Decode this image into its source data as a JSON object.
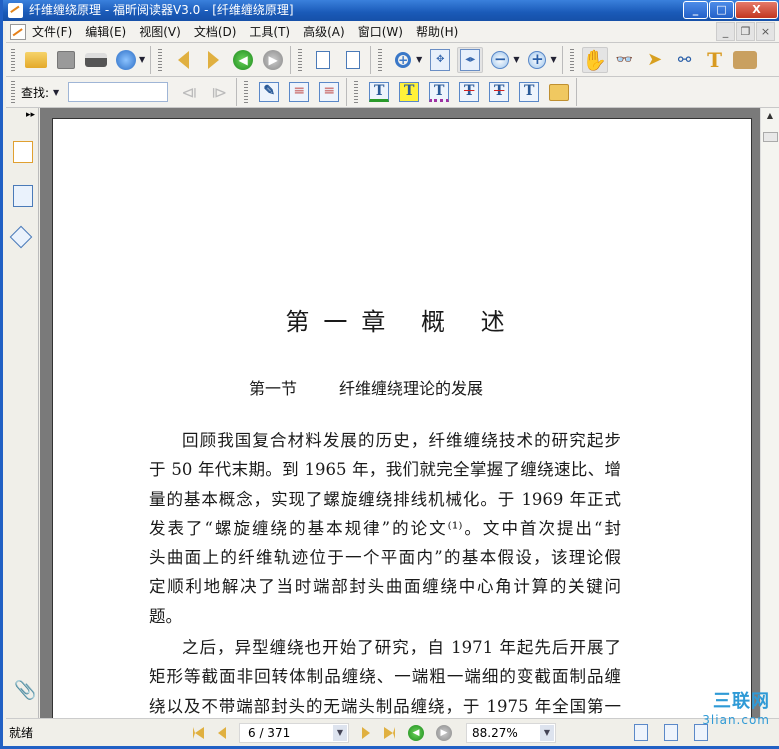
{
  "window": {
    "title": "纤维缠绕原理 - 福昕阅读器V3.0 - [纤维缠绕原理]",
    "minimize": "_",
    "maximize": "□",
    "close": "X"
  },
  "menu": [
    "文件(F)",
    "编辑(E)",
    "视图(V)",
    "文档(D)",
    "工具(T)",
    "高级(A)",
    "窗口(W)",
    "帮助(H)"
  ],
  "mdi": {
    "minimize": "_",
    "restore": "❐",
    "close": "×"
  },
  "find": {
    "label": "查找:",
    "value": "",
    "dropdown": "▼"
  },
  "sidebar": {
    "expand": "▸▸"
  },
  "document": {
    "chapter": "第一章 概 述",
    "section_num": "第一节",
    "section_title": "纤维缠绕理论的发展",
    "para1": [
      "回顾我国复合材料发展的历史，纤维缠绕技术的研究起步",
      "于 50 年代末期。到 1965 年，我们就完全掌握了缠绕速比、增",
      "量的基本概念，实现了螺旋缠绕排线机械化。于 1969 年正式",
      "发表了“螺旋缠绕的基本规律”的论文⁽¹⁾。文中首次提出“封",
      "头曲面上的纤维轨迹位于一个平面内”的基本假设，该理论假",
      "定顺利地解决了当时端部封头曲面缠绕中心角计算的关键问",
      "题。"
    ],
    "para2": [
      "之后，异型缠绕也开始了研究，自 1971 年起先后开展了",
      "矩形等截面非回转体制品缠绕、一端粗一端细的变截面制品缠",
      "绕以及不带端部封头的无端头制品缠绕，于 1975 年全国第一"
    ]
  },
  "status": {
    "text": "就绪",
    "page": "6 / 371",
    "zoom": "88.27%",
    "dropdown": "▼"
  },
  "watermark": {
    "line1": "三联网",
    "line2": "3lian.com"
  }
}
